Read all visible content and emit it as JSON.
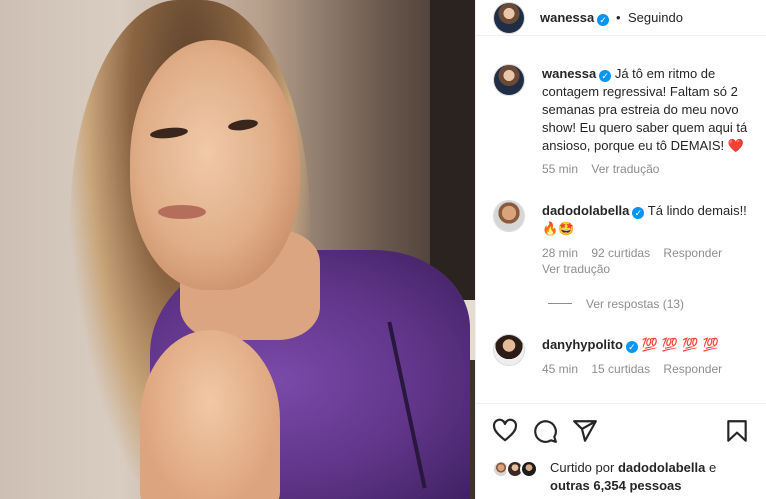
{
  "post": {
    "author": "wanessa",
    "follow_separator": "•",
    "follow_label": "Seguindo"
  },
  "caption": {
    "username": "wanessa",
    "text": "Já tô em ritmo de contagem regressiva! Faltam só 2 semanas pra estreia do meu novo show! Eu quero saber quem aqui tá ansioso, porque eu tô DEMAIS!",
    "emoji": "❤️",
    "time": "55 min",
    "translate": "Ver tradução"
  },
  "comments": [
    {
      "username": "dadodolabella",
      "text": "Tá lindo demais!!",
      "emoji": "🔥🤩",
      "time": "28 min",
      "likes": "92 curtidas",
      "reply": "Responder",
      "translate": "Ver tradução",
      "view_replies": "Ver respostas (13)"
    },
    {
      "username": "danyhypolito",
      "emoji": "💯 💯 💯 💯",
      "time": "45 min",
      "likes": "15 curtidas",
      "reply": "Responder"
    }
  ],
  "actions": {
    "like_icon": "heart-icon",
    "comment_icon": "comment-icon",
    "share_icon": "share-icon",
    "save_icon": "bookmark-icon"
  },
  "likes_summary": {
    "prefix": "Curtido por",
    "user": "dadodolabella",
    "suffix": "e",
    "others": "outras 6,354 pessoas"
  },
  "colors": {
    "verified": "#0095f6",
    "meta_text": "#8e8e8e",
    "border": "#efefef"
  }
}
